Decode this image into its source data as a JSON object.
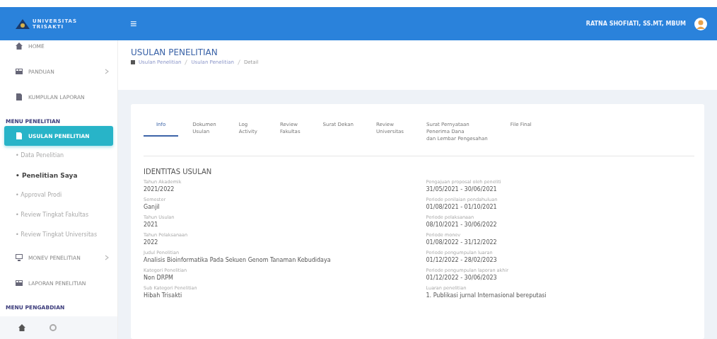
{
  "topbar": {
    "logo": "UNIVERSITAS TRISAKTI",
    "menu_icon": "≡",
    "user": "RATNA SHOFIATI, SS.MT, MBUM"
  },
  "sidebar": {
    "items": [
      {
        "kind": "item",
        "label": "HOME",
        "selected": false
      },
      {
        "kind": "item",
        "label": "PANDUAN",
        "selected": false,
        "expandable": true
      },
      {
        "kind": "item",
        "label": "KUMPULAN LAPORAN",
        "selected": false
      },
      {
        "kind": "heading",
        "label": "MENU PENELITIAN"
      },
      {
        "kind": "item",
        "label": "USULAN PENELITIAN",
        "selected": true
      },
      {
        "kind": "sub",
        "label": "• Data Penelitian",
        "selected": false
      },
      {
        "kind": "sub",
        "label": "• Penelitian Saya",
        "selected": true
      },
      {
        "kind": "sub",
        "label": "• Approval Prodi",
        "selected": false
      },
      {
        "kind": "sub",
        "label": "• Review Tingkat Fakultas",
        "selected": false
      },
      {
        "kind": "sub",
        "label": "• Review Tingkat Universitas",
        "selected": false
      },
      {
        "kind": "item",
        "label": "MONEV PENELITIAN",
        "selected": false,
        "expandable": true
      },
      {
        "kind": "item",
        "label": "LAPORAN PENELITIAN",
        "selected": false
      },
      {
        "kind": "heading",
        "label": "MENU PENGABDIAN"
      }
    ]
  },
  "page_header": {
    "title": "USULAN PENELITIAN",
    "breadcrumb": [
      "Usulan Penelitian",
      "Usulan Penelitian",
      "Detail"
    ]
  },
  "tabs": [
    {
      "label": "Info",
      "selected": true
    },
    {
      "label": "Dokumen\nUsulan",
      "selected": false
    },
    {
      "label": "Log\nActivity",
      "selected": false
    },
    {
      "label": "Review\nFakultas",
      "selected": false
    },
    {
      "label": "Surat Dekan",
      "selected": false
    },
    {
      "label": "Review\nUniversitas",
      "selected": false
    },
    {
      "label": "Surat Pernyataan\nPenerima Dana\ndan Lembar Pengesahan",
      "selected": false
    },
    {
      "label": "File Final",
      "selected": false
    }
  ],
  "section_title": "IDENTITAS USULAN",
  "left_fields": [
    {
      "label": "Tahun Akademik",
      "value": "2021/2022"
    },
    {
      "label": "Semester",
      "value": "Ganjil"
    },
    {
      "label": "Tahun Usulan",
      "value": "2021"
    },
    {
      "label": "Tahun Pelaksanaan",
      "value": "2022"
    },
    {
      "label": "Judul Penelitian",
      "value": "Analisis Bioinformatika Pada Sekuen Genom Tanaman Kebudidaya"
    },
    {
      "label": "Kategori Penelitian",
      "value": "Non DRPM"
    },
    {
      "label": "Sub Kategori Penelitian",
      "value": "Hibah Trisakti"
    }
  ],
  "right_fields": [
    {
      "label": "Pengajuan proposal oleh peneliti",
      "value": "31/05/2021 - 30/06/2021"
    },
    {
      "label": "Periode penilaian pendahuluan",
      "value": "01/08/2021 - 01/10/2021"
    },
    {
      "label": "Periode pelaksanaan",
      "value": "08/10/2021 - 30/06/2022"
    },
    {
      "label": "Periode monev",
      "value": "01/08/2022 - 31/12/2022"
    },
    {
      "label": "Periode pengumpulan luaran",
      "value": "01/12/2022 - 28/02/2023"
    },
    {
      "label": "Periode pengumpulan laporan akhir",
      "value": "01/12/2022 - 30/06/2023"
    },
    {
      "label": "Luaran penelitian",
      "value": "1. Publikasi jurnal Internasional bereputasi"
    }
  ]
}
